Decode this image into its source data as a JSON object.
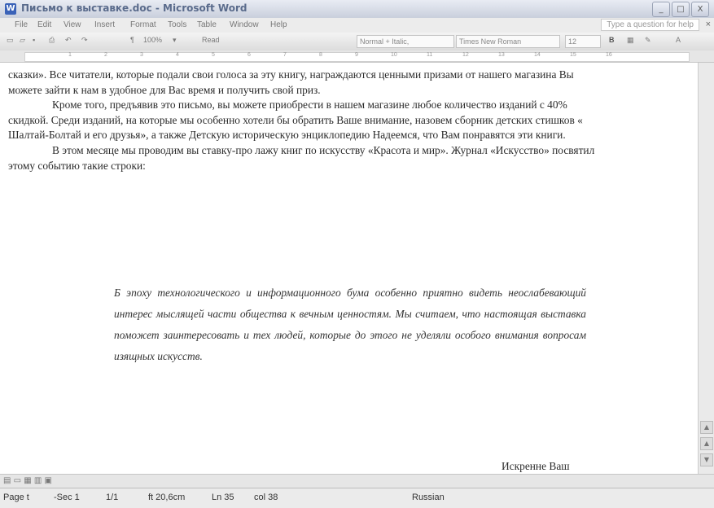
{
  "window": {
    "title": "Письмо к выставке.doc - Microsoft Word",
    "controls": [
      "_",
      "□",
      "X"
    ]
  },
  "menu": {
    "items": [
      "File",
      "Edit",
      "View",
      "Insert",
      "Format",
      "Tools",
      "Table",
      "Window",
      "Help"
    ],
    "help_placeholder": "Type a question for help"
  },
  "toolbar": {
    "zoom": "100%",
    "read_label": "Read",
    "style": "Normal + Italic,",
    "font": "Times New Roman",
    "size": "12",
    "bold": "B"
  },
  "ruler": {
    "ticks": [
      "1",
      "2",
      "3",
      "4",
      "5",
      "6",
      "7",
      "8",
      "9",
      "10",
      "11",
      "12",
      "13",
      "14",
      "15",
      "16"
    ]
  },
  "document": {
    "paragraph1": "сказки». Все читатели, которые подали свои голоса за эту книгу, награждаются ценными призами от нашего магазина Вы можете зайти к нам в удобное для Вас время и получить свой приз.",
    "paragraph2": "Кроме того, предъявив это письмо, вы можете приобрести в нашем магазине любое количество изданий с 40% скидкой. Среди изданий, на которые мы особенно хотели бы обратить Ваше внимание, назовем сборник детских стишков « Шалтай-Болтай и его друзья», а также Детскую историческую энциклопедию Надеемся, что Вам понравятся эти книги.",
    "paragraph3": "В этом месяце мы проводим вы ставку-про лажу книг по искусству «Красота и мир». Журнал «Искусство» посвятил этому событию такие строки:",
    "quote": "Б эпоху технологического и информационного бума особенно приятно видеть неослабевающий интерес мыслящей части общества к вечным ценностям. Мы считаем, что настоящая выставка поможет заинтересовать и тех людей, которые до этого не уделяли особого внимания вопросам изящных искусств.",
    "signature": "Искренне Ваш"
  },
  "status": {
    "page": "Page t",
    "sec": "-Sec 1",
    "pages": "1/1",
    "at": "ft 20,6cm",
    "ln": "Ln 35",
    "col": "col 38",
    "language": "Russian"
  }
}
